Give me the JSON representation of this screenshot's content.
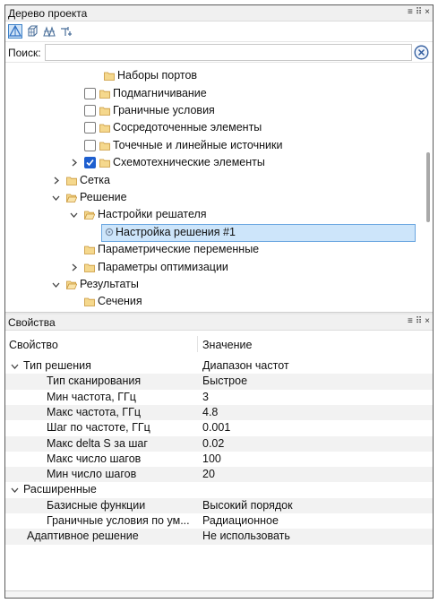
{
  "tree_panel": {
    "title": "Дерево проекта",
    "controls": [
      "≡",
      "⠿",
      "×"
    ],
    "search_label": "Поиск:",
    "search_value": "",
    "items": [
      {
        "label": "Наборы портов",
        "checkbox": "none",
        "expandable": false
      },
      {
        "label": "Подмагничивание",
        "checkbox": "unchecked",
        "expandable": false
      },
      {
        "label": "Граничные условия",
        "checkbox": "unchecked",
        "expandable": false
      },
      {
        "label": "Сосредоточенные элементы",
        "checkbox": "unchecked",
        "expandable": false
      },
      {
        "label": "Точечные и линейные источники",
        "checkbox": "unchecked",
        "expandable": false
      },
      {
        "label": "Схемотехнические элементы",
        "checkbox": "checked",
        "expandable": true
      },
      {
        "label": "Сетка",
        "expandable": true,
        "expanded": false
      },
      {
        "label": "Решение",
        "expandable": true,
        "expanded": true
      },
      {
        "label": "Настройки решателя",
        "expandable": true,
        "expanded": true
      },
      {
        "label": "Настройка решения #1",
        "selected": true
      },
      {
        "label": "Параметрические переменные"
      },
      {
        "label": "Параметры оптимизации",
        "expandable": true,
        "expanded": false
      },
      {
        "label": "Результаты",
        "expandable": true,
        "expanded": true
      },
      {
        "label": "Сечения"
      }
    ]
  },
  "props_panel": {
    "title": "Свойства",
    "controls": [
      "≡",
      "⠿",
      "×"
    ],
    "col_property": "Свойство",
    "col_value": "Значение",
    "rows": [
      {
        "name": "Тип решения",
        "value": "Диапазон частот",
        "group": true
      },
      {
        "name": "Тип сканирования",
        "value": "Быстрое"
      },
      {
        "name": "Мин частота, ГГц",
        "value": "3"
      },
      {
        "name": "Макс частота, ГГц",
        "value": "4.8"
      },
      {
        "name": "Шаг по частоте, ГГц",
        "value": "0.001"
      },
      {
        "name": "Макс delta S за шаг",
        "value": "0.02"
      },
      {
        "name": "Макс число шагов",
        "value": "100"
      },
      {
        "name": "Мин число шагов",
        "value": "20"
      },
      {
        "name": "Расширенные",
        "value": "",
        "group": true
      },
      {
        "name": "Базисные функции",
        "value": "Высокий порядок"
      },
      {
        "name": "Граничные условия по ум...",
        "value": "Радиационное"
      },
      {
        "name": "Адаптивное решение",
        "value": "Не использовать"
      }
    ]
  },
  "colors": {
    "accent": "#1e5fcf",
    "selection": "#cde5fa",
    "folder": "#f2c66d"
  }
}
